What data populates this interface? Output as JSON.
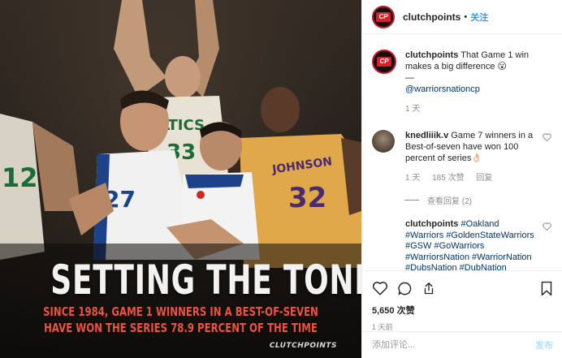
{
  "image": {
    "headline": "SETTING THE TONE",
    "subline_1": "SINCE 1984, GAME 1 WINNERS IN A BEST-OF-SEVEN",
    "subline_2": "HAVE WON THE SERIES 78.9 PERCENT OF THE TIME",
    "watermark": "CLUTCHPOINTS",
    "jersey_text_1": "LTICS",
    "jersey_num_1": "33",
    "jersey_text_2": "JOHNSON",
    "jersey_num_2": "32",
    "jersey_num_3": "27",
    "jersey_num_4": "12"
  },
  "header": {
    "avatar_text": "CP",
    "username": "clutchpoints",
    "separator": "•",
    "follow_label": "关注"
  },
  "caption": {
    "username": "clutchpoints",
    "text": "That Game 1 win makes a big difference 😮",
    "dash": "—",
    "mention": "@warriorsnationcp",
    "time": "1 天"
  },
  "comments": [
    {
      "username": "knedliiik.v",
      "text": "Game 7 winners in a Best-of-seven have won 100 percent of series👌🏻",
      "time": "1 天",
      "likes": "185 次赞",
      "reply": "回复"
    }
  ],
  "more_replies": "查看回复 (2)",
  "tags_comment": {
    "username": "clutchpoints",
    "tags_line1": "#Oakland",
    "tags_line2": "#Warriors #GoldenStateWarriors",
    "tags_line3": "#GSW #GoWarriors",
    "tags_line4": "#WarriorsNation #WarriorNation",
    "tags_line5": "#DubsNation #DubNation"
  },
  "actions": {
    "likes": "5,650 次赞",
    "time": "1 天前"
  },
  "comment_box": {
    "placeholder": "添加评论...",
    "post_label": "发布"
  },
  "colors": {
    "accent": "#3897f0",
    "brand_red": "#d81f2a",
    "headline": "#f2f2f2",
    "subline": "#e8543f"
  }
}
